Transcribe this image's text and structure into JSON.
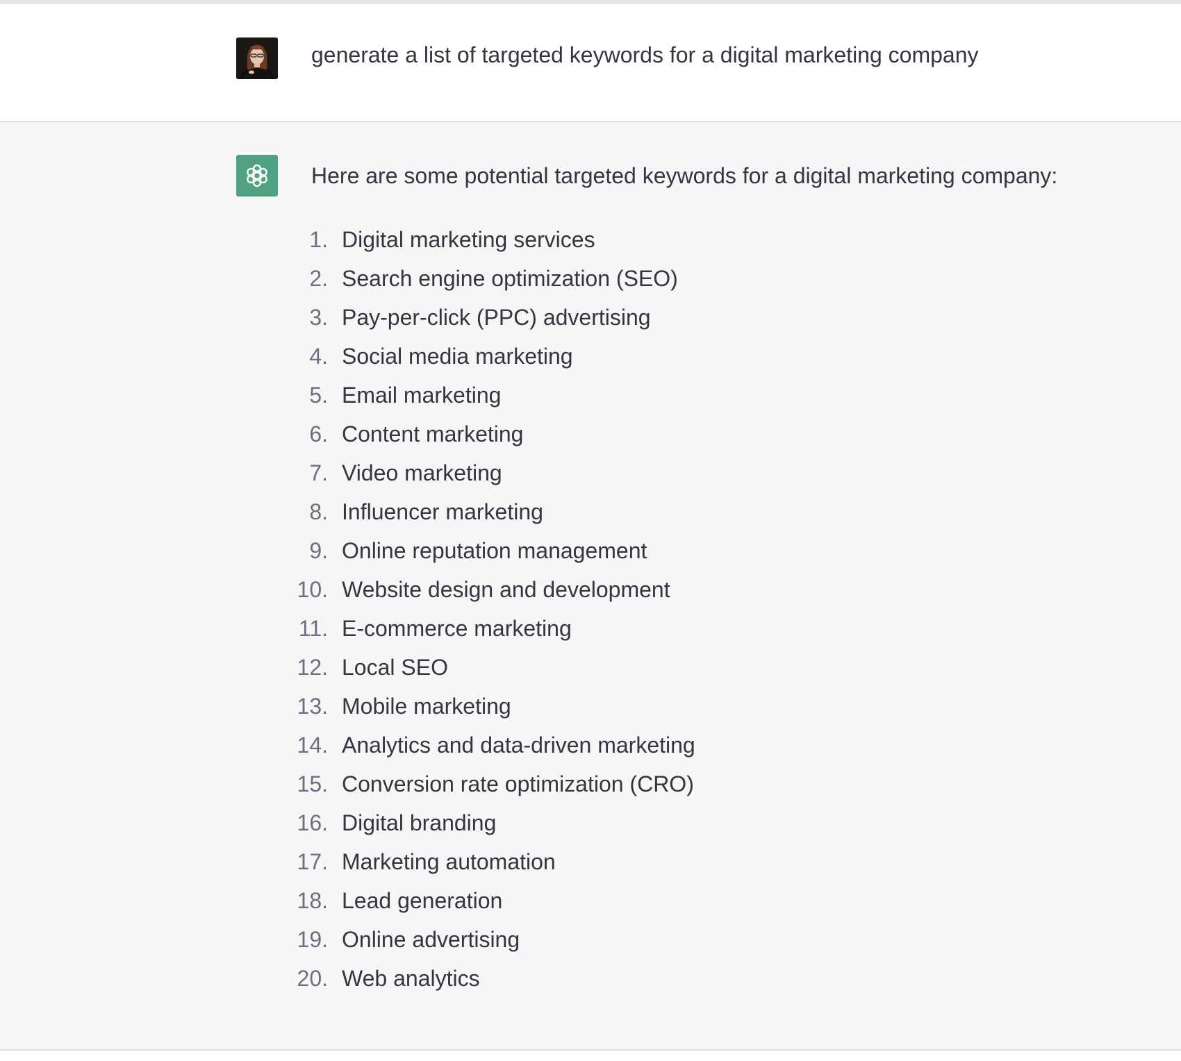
{
  "conversation": {
    "user_message": {
      "text": "generate a list of targeted keywords for a digital marketing company",
      "avatar_icon": "user-photo-avatar"
    },
    "assistant_message": {
      "intro": "Here are some potential targeted keywords for a digital marketing company:",
      "avatar_icon": "openai-logo-icon",
      "avatar_color": "#4fa182",
      "keywords": [
        {
          "num": "1.",
          "label": "Digital marketing services"
        },
        {
          "num": "2.",
          "label": "Search engine optimization (SEO)"
        },
        {
          "num": "3.",
          "label": "Pay-per-click (PPC) advertising"
        },
        {
          "num": "4.",
          "label": "Social media marketing"
        },
        {
          "num": "5.",
          "label": "Email marketing"
        },
        {
          "num": "6.",
          "label": "Content marketing"
        },
        {
          "num": "7.",
          "label": "Video marketing"
        },
        {
          "num": "8.",
          "label": "Influencer marketing"
        },
        {
          "num": "9.",
          "label": "Online reputation management"
        },
        {
          "num": "10.",
          "label": "Website design and development"
        },
        {
          "num": "11.",
          "label": "E-commerce marketing"
        },
        {
          "num": "12.",
          "label": "Local SEO"
        },
        {
          "num": "13.",
          "label": "Mobile marketing"
        },
        {
          "num": "14.",
          "label": "Analytics and data-driven marketing"
        },
        {
          "num": "15.",
          "label": "Conversion rate optimization (CRO)"
        },
        {
          "num": "16.",
          "label": "Digital branding"
        },
        {
          "num": "17.",
          "label": "Marketing automation"
        },
        {
          "num": "18.",
          "label": "Lead generation"
        },
        {
          "num": "19.",
          "label": "Online advertising"
        },
        {
          "num": "20.",
          "label": "Web analytics"
        }
      ]
    }
  },
  "colors": {
    "text": "#343541",
    "list_number": "#6e6e80",
    "assistant_background": "#f6f6f7",
    "user_background": "#ffffff"
  }
}
